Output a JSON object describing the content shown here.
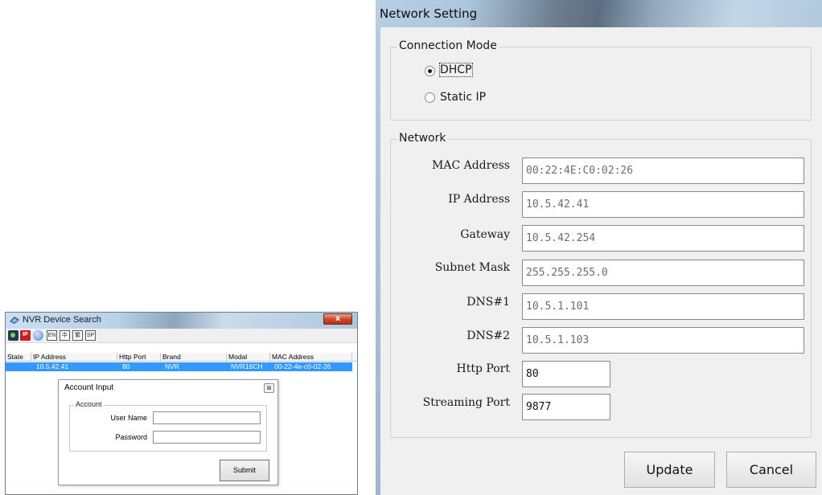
{
  "nvr_window": {
    "title": "NVR Device Search",
    "close_glyph": "x",
    "toolbar": {
      "ip_label": "IP",
      "en_label": "EN",
      "cn_label": "中",
      "tw_label": "繁",
      "sp_label": "SP"
    },
    "columns": [
      "State",
      "IP Address",
      "Http Port",
      "Brand",
      "Modal",
      "MAC Address"
    ],
    "rows": [
      {
        "state": "",
        "ip": "10.5.42.41",
        "port": "80",
        "brand": "NVR",
        "model": "NVR16CH",
        "mac": "00-22-4e-c0-02-26"
      }
    ],
    "account_dialog": {
      "title": "Account Input",
      "close_glyph": "⊠",
      "group_label": "Account",
      "username_label": "User Name",
      "username_value": "",
      "password_label": "Password",
      "password_value": "",
      "submit_label": "Submit"
    }
  },
  "network_window": {
    "title": "Network Setting",
    "connection_mode": {
      "label": "Connection Mode",
      "options": [
        {
          "label": "DHCP",
          "selected": true
        },
        {
          "label": "Static IP",
          "selected": false
        }
      ]
    },
    "network": {
      "label": "Network",
      "fields": {
        "mac": {
          "label": "MAC Address",
          "value": "00:22:4E:C0:02:26"
        },
        "ip": {
          "label": "IP Address",
          "value": "10.5.42.41"
        },
        "gateway": {
          "label": "Gateway",
          "value": "10.5.42.254"
        },
        "subnet": {
          "label": "Subnet Mask",
          "value": "255.255.255.0"
        },
        "dns1": {
          "label": "DNS#1",
          "value": "10.5.1.101"
        },
        "dns2": {
          "label": "DNS#2",
          "value": "10.5.1.103"
        },
        "http_port": {
          "label": "Http Port",
          "value": "80"
        },
        "streaming_port": {
          "label": "Streaming Port",
          "value": "9877"
        }
      }
    },
    "buttons": {
      "update": "Update",
      "cancel": "Cancel"
    }
  }
}
